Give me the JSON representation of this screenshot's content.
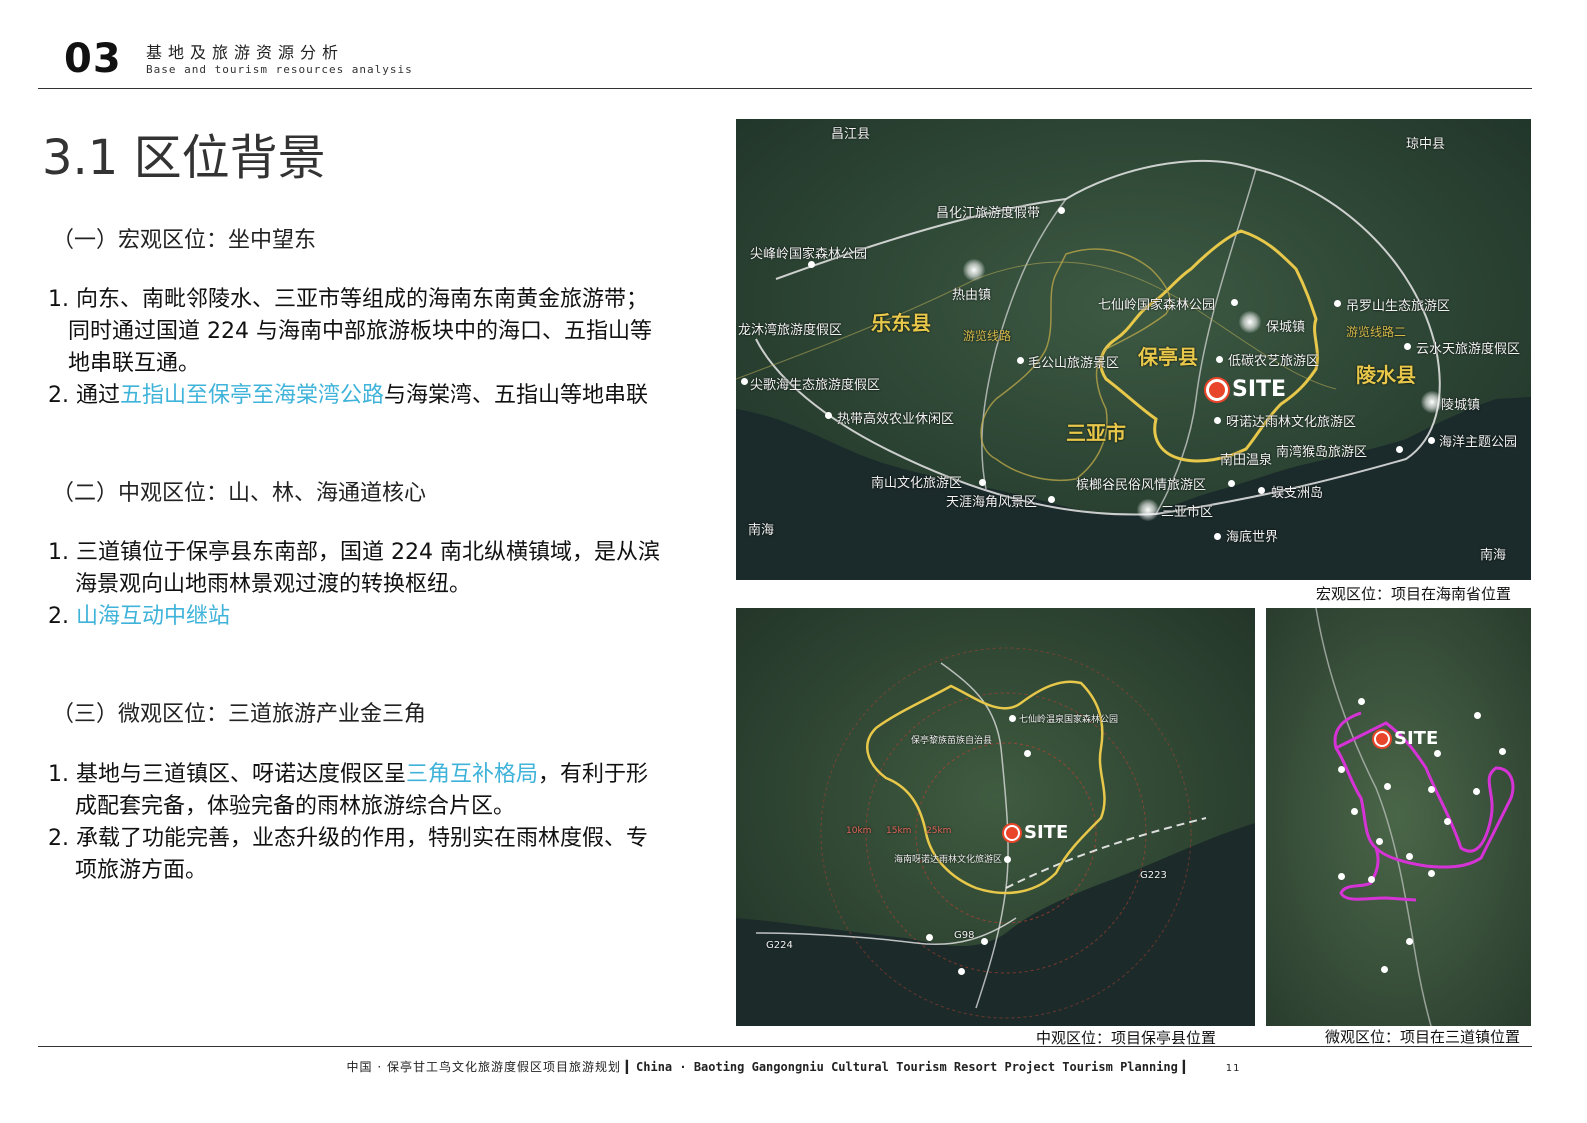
{
  "header": {
    "number": "03",
    "title_cn": "基地及旅游资源分析",
    "title_en": "Base and tourism resources analysis"
  },
  "title": "3.1 区位背景",
  "sections": [
    {
      "heading": "（一）宏观区位：坐中望东",
      "items": [
        {
          "n1": "1. 向东、南毗邻陵水、三亚市等组成的海南东南黄金旅游带；",
          "n1b": "同时通过国道 224 与海南中部旅游板块中的海口、五指山等",
          "n1c": "地串联互通。"
        },
        {
          "prefix": "2. 通过",
          "highlight": "五指山至保亭至海棠湾公路",
          "suffix": "与海棠湾、五指山等地串联"
        }
      ]
    },
    {
      "heading": "（二）中观区位：山、林、海通道核心",
      "l1": "1. 三道镇位于保亭县东南部，国道 224 南北纵横镇域，是从滨",
      "l2": "海景观向山地雨林景观过渡的转换枢纽。",
      "l3_prefix": "2. ",
      "l3_highlight": "山海互动中继站"
    },
    {
      "heading": "（三）微观区位：三道旅游产业金三角",
      "l1_prefix": "1. 基地与三道镇区、呀诺达度假区呈",
      "l1_highlight": "三角互补格局",
      "l1_suffix": "，有利于形",
      "l2": "成配套完备，体验完备的雨林旅游综合片区。",
      "l3": "2. 承载了功能完善，业态升级的作用，特别实在雨林度假、专",
      "l4": "项旅游方面。"
    }
  ],
  "maps": {
    "macro": {
      "caption": "宏观区位：项目在海南省位置",
      "labels": {
        "changjiang": "昌江县",
        "qiongzhong": "琼中县",
        "changhuajiang": "昌化江旅游度假带",
        "jianfengling": "尖峰岭国家森林公园",
        "redai": "热由镇",
        "ledong": "乐东县",
        "longmu": "龙沐湾旅游度假区",
        "youlan": "游览线路",
        "qixianling": "七仙岭国家森林公园",
        "baocheng": "保城镇",
        "diaoluo": "吊罗山生态旅游区",
        "youlan2": "游览线路二",
        "yunshui": "云水天旅游度假区",
        "maogong": "毛公山旅游景区",
        "baoting": "保亭县",
        "diluo": "低碳农艺旅游区",
        "lingshui": "陵水县",
        "jiange": "尖歌海生态旅游度假区",
        "reyun": "热带高效农业休闲区",
        "sanya": "三亚市",
        "yanuoda": "呀诺达雨林文化旅游区",
        "lingcheng": "陵城镇",
        "haiyang": "海洋主题公园",
        "nantian": "南田温泉",
        "nanwan": "南湾猴岛旅游区",
        "nanshan": "南山文化旅游区",
        "binlang": "槟榔谷民俗风情旅游区",
        "tianya": "天涯海角风景区",
        "sanyashi": "三亚市区",
        "wuzhizhou": "蜈支洲岛",
        "nanhai1": "南海",
        "nanhai2": "南海",
        "haidi": "海底世界",
        "site": "SITE"
      }
    },
    "meso": {
      "caption": "中观区位：项目保亭县位置",
      "labels": {
        "site": "SITE",
        "qixian": "七仙岭温泉国家森林公园",
        "baoting_town": "保亭黎族苗族自治县",
        "yanuoda": "海南呀诺达雨林文化旅游区",
        "r10": "10km",
        "r15": "15km",
        "r25": "25km",
        "g223": "G223",
        "g98": "G98",
        "g224": "G224"
      }
    },
    "micro": {
      "caption": "微观区位：项目在三道镇位置",
      "labels": {
        "site": "SITE"
      }
    }
  },
  "footer": {
    "cn": "中国 · 保亭甘工鸟文化旅游度假区项目旅游规划",
    "en": "China · Baoting Gangongniu Cultural Tourism Resort Project Tourism Planning",
    "page": "11"
  },
  "colors": {
    "highlight": "#3fb3d9",
    "boundary": "#e8c84a",
    "site": "#e8452a",
    "route": "#d633d6"
  }
}
